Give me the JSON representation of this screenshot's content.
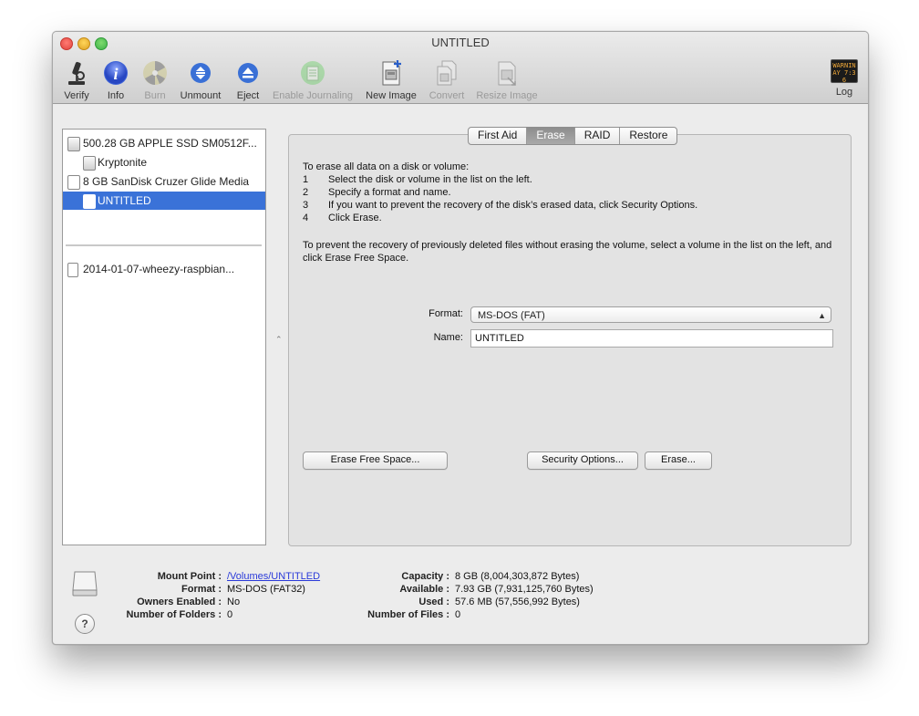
{
  "window": {
    "title": "UNTITLED"
  },
  "toolbar": {
    "verify": "Verify",
    "info": "Info",
    "burn": "Burn",
    "unmount": "Unmount",
    "eject": "Eject",
    "enable_journaling": "Enable Journaling",
    "new_image": "New Image",
    "convert": "Convert",
    "resize_image": "Resize Image",
    "log": "Log",
    "log_screen": "WARNIN AY 7:36"
  },
  "sidebar": {
    "items": [
      {
        "label": "500.28 GB APPLE SSD SM0512F...",
        "type": "disk"
      },
      {
        "label": "Kryptonite",
        "type": "volume"
      },
      {
        "label": "8 GB SanDisk Cruzer Glide Media",
        "type": "disk"
      },
      {
        "label": "UNTITLED",
        "type": "volume",
        "selected": true
      },
      {
        "label": "2014-01-07-wheezy-raspbian...",
        "type": "image"
      }
    ]
  },
  "tabs": [
    "First Aid",
    "Erase",
    "RAID",
    "Restore"
  ],
  "active_tab": "Erase",
  "erase": {
    "intro": "To erase all data on a disk or volume:",
    "steps": [
      {
        "num": "1",
        "text": "Select the disk or volume in the list on the left."
      },
      {
        "num": "2",
        "text": "Specify a format and name."
      },
      {
        "num": "3",
        "text": "If you want to prevent the recovery of the disk’s erased data, click Security Options."
      },
      {
        "num": "4",
        "text": "Click Erase."
      }
    ],
    "free_space_note": "To prevent the recovery of previously deleted files without erasing the volume, select a volume in the list on the left, and click Erase Free Space.",
    "format_label": "Format:",
    "format_value": "MS-DOS (FAT)",
    "name_label": "Name:",
    "name_value": "UNTITLED",
    "erase_free_space_button": "Erase Free Space...",
    "security_options_button": "Security Options...",
    "erase_button": "Erase..."
  },
  "details": {
    "mount_point_label": "Mount Point :",
    "mount_point_value": "/Volumes/UNTITLED",
    "format_label": "Format :",
    "format_value": "MS-DOS (FAT32)",
    "owners_label": "Owners Enabled :",
    "owners_value": "No",
    "folders_label": "Number of Folders :",
    "folders_value": "0",
    "capacity_label": "Capacity :",
    "capacity_value": "8 GB (8,004,303,872 Bytes)",
    "available_label": "Available :",
    "available_value": "7.93 GB (7,931,125,760 Bytes)",
    "used_label": "Used :",
    "used_value": "57.6 MB (57,556,992 Bytes)",
    "files_label": "Number of Files :",
    "files_value": "0"
  },
  "help": "?"
}
